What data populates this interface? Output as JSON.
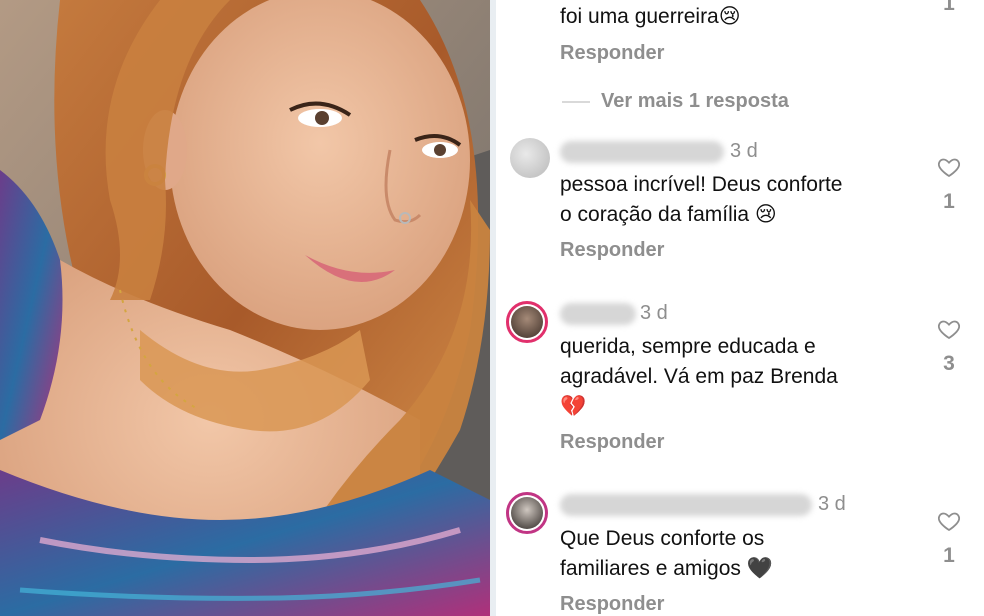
{
  "photo": {
    "alt": ""
  },
  "top": {
    "text": "foi uma guerreira😢",
    "reply": "Responder",
    "count": "1",
    "view_more": "Ver mais 1 resposta"
  },
  "comments": [
    {
      "time": "3 d",
      "line1": "pessoa incrível! Deus conforte",
      "line2": "o coração da família 😢",
      "line3": "",
      "reply": "Responder",
      "count": "1"
    },
    {
      "time": "3 d",
      "line1": "querida, sempre educada e",
      "line2": "agradável. Vá em paz Brenda",
      "line3": "💔",
      "reply": "Responder",
      "count": "3"
    },
    {
      "time": "3 d",
      "line1": "Que Deus conforte os",
      "line2": "familiares e amigos 🖤",
      "line3": "",
      "reply": "Responder",
      "count": "1"
    }
  ],
  "colors": {
    "muted": "#8e8e8e",
    "text": "#111111",
    "story_ring": "#e1306c"
  },
  "icons": [
    "heart-outline-icon"
  ]
}
